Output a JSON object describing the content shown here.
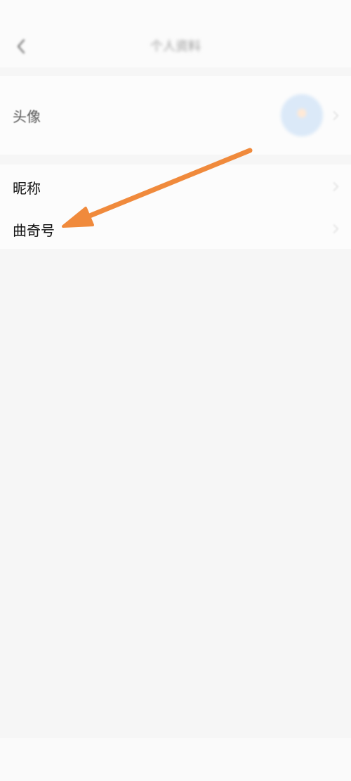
{
  "status_bar": {
    "left_text": "",
    "right_text": ""
  },
  "header": {
    "title": "个人资料",
    "back_icon": "chevron-left-icon"
  },
  "profile": {
    "avatar_label": "头像",
    "avatar_icon": "avatar-image",
    "nickname_label": "昵称",
    "nickname_value": "",
    "id_label": "曲奇号",
    "id_value_left": "",
    "id_value_right": ""
  },
  "annotation": {
    "arrow_color": "#f08a3c"
  },
  "colors": {
    "page_background": "#f6f6f6",
    "section_background": "#fcfcfc",
    "accent_arrow": "#f08a3c"
  }
}
